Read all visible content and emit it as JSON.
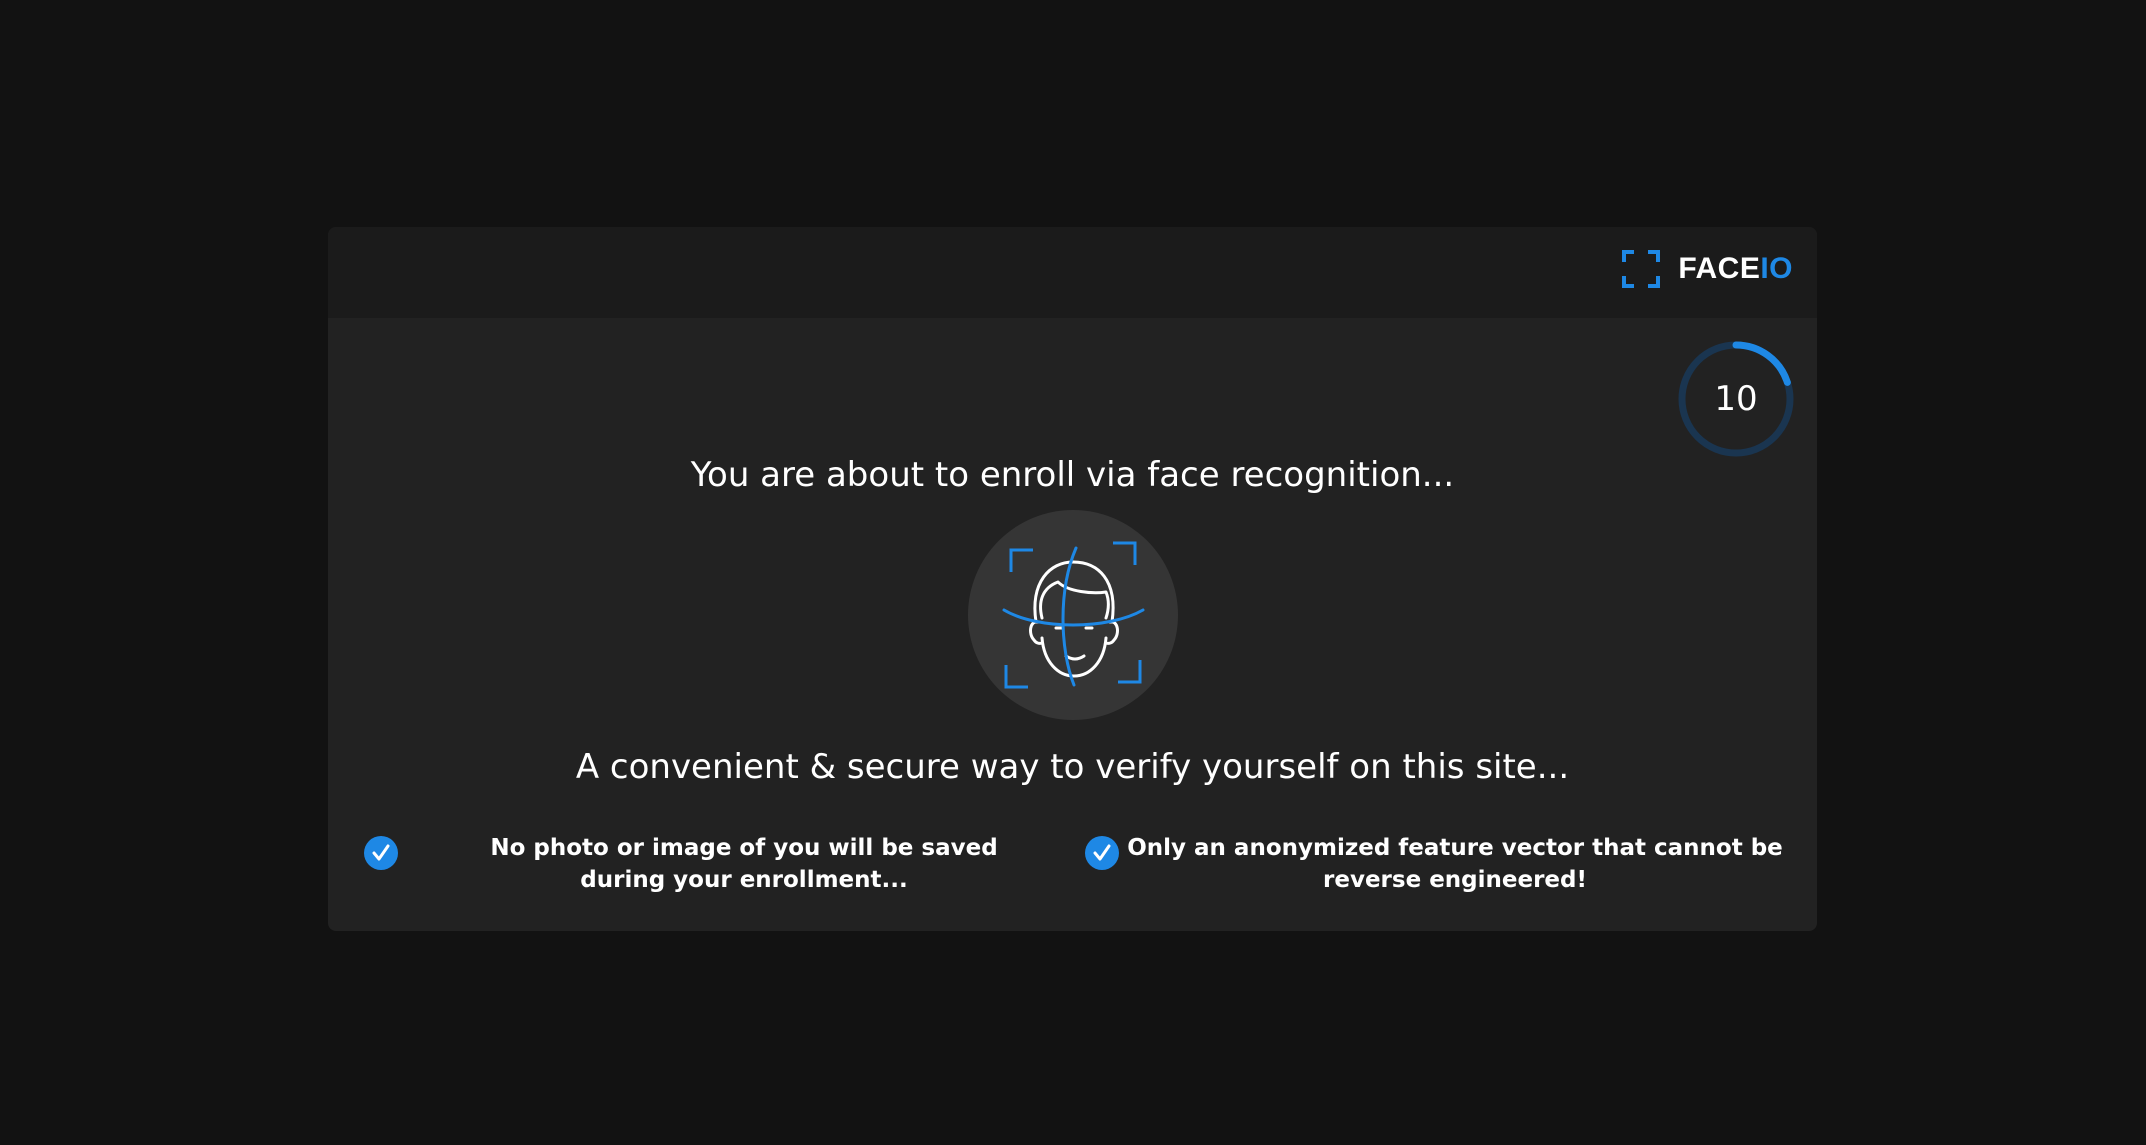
{
  "brand": {
    "name_main": "FACE",
    "name_accent": "IO",
    "icon": "face-frame-icon",
    "accent_color": "#1e88e5"
  },
  "countdown": {
    "value": "10",
    "progress": 0.2
  },
  "main": {
    "headline": "You are about to enroll via face recognition...",
    "illustration_icon": "face-scan-icon",
    "subline": "A convenient & secure way to verify yourself on this site..."
  },
  "features": [
    {
      "icon": "check-icon",
      "text": "No photo or image of you will be saved during your enrollment..."
    },
    {
      "icon": "check-icon",
      "text": "Only an anonymized feature vector that cannot be reverse engineered!"
    }
  ],
  "colors": {
    "background": "#121212",
    "modal": "#222222",
    "header": "#1b1b1b",
    "accent": "#1e88e5"
  }
}
